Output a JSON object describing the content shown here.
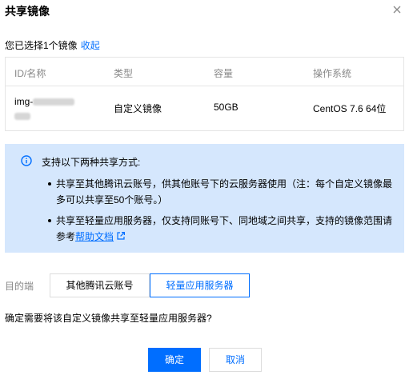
{
  "dialog": {
    "title": "共享镜像",
    "selected_text": "您已选择1个镜像",
    "collapse_link": "收起"
  },
  "table": {
    "headers": [
      "ID/名称",
      "类型",
      "容量",
      "操作系统"
    ],
    "row": {
      "id_prefix": "img-",
      "type": "自定义镜像",
      "capacity": "50GB",
      "os": "CentOS 7.6 64位"
    }
  },
  "info": {
    "heading": "支持以下两种共享方式:",
    "item1": "共享至其他腾讯云账号，供其他账号下的云服务器使用（注：每个自定义镜像最多可以共享至50个账号。）",
    "item2_prefix": "共享至轻量应用服务器，仅支持同账号下、同地域之间共享，支持的镜像范围请参考",
    "item2_link": "帮助文档",
    "colors": {
      "background": "#d5e7fd",
      "accent": "#006eff"
    }
  },
  "destination": {
    "label": "目的端",
    "options": [
      "其他腾讯云账号",
      "轻量应用服务器"
    ],
    "selected": "轻量应用服务器"
  },
  "confirm_question": "确定需要将该自定义镜像共享至轻量应用服务器?",
  "buttons": {
    "ok": "确定",
    "cancel": "取消"
  }
}
